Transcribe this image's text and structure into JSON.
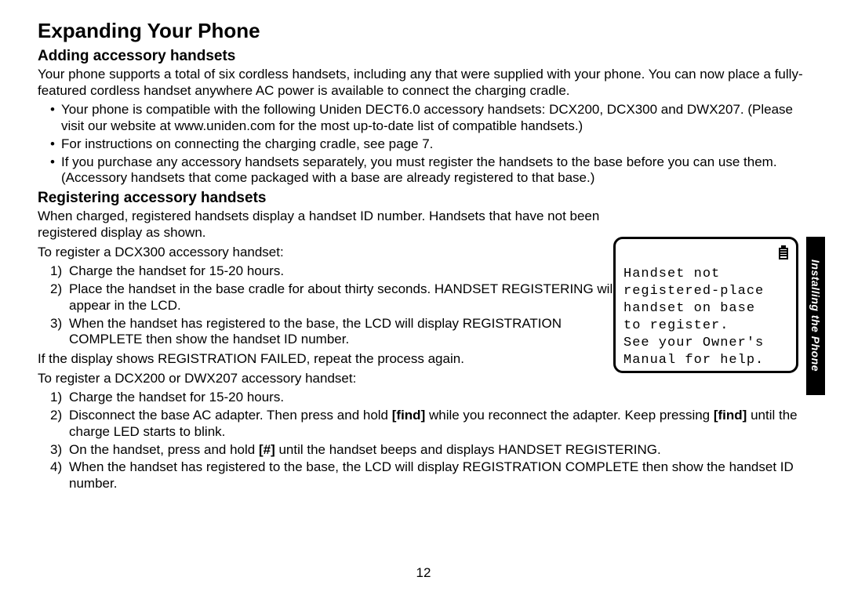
{
  "title": "Expanding Your Phone",
  "side_tab": "Installing the Phone",
  "page_number": "12",
  "sec1": {
    "heading": "Adding accessory handsets",
    "intro": "Your phone supports a total of six cordless handsets, including any that were supplied with your phone. You can now place a fully-featured cordless handset anywhere AC power is available to connect the charging cradle.",
    "bullets": [
      "Your phone is compatible with the following Uniden DECT6.0 accessory handsets: DCX200, DCX300 and DWX207. (Please visit our website at www.uniden.com for the most up-to-date list of compatible handsets.)",
      "For instructions on connecting the charging cradle, see page 7.",
      "If you purchase any accessory handsets separately, you must register the handsets to the base before you can use them. (Accessory handsets that come packaged with a base are already registered to that base.)"
    ]
  },
  "sec2": {
    "heading": "Registering accessory handsets",
    "p1": "When charged, registered handsets display a handset ID number. Handsets that have not been registered display as shown.",
    "p2": "To register a DCX300 accessory handset:",
    "steps1": [
      "Charge the handset for 15-20 hours.",
      "Place the handset in the base cradle for about thirty seconds. HANDSET REGISTERING will appear in the LCD.",
      "When the handset has registered to the base, the LCD will display REGISTRATION COMPLETE then show the handset ID number."
    ],
    "p3": "If the display shows REGISTRATION FAILED, repeat the process again.",
    "p4": "To register a DCX200 or DWX207 accessory handset:",
    "steps2_1": "Charge the handset for 15-20 hours.",
    "steps2_2a": "Disconnect the base AC adapter. Then press and hold ",
    "steps2_2b": "[find]",
    "steps2_2c": " while you reconnect the adapter. Keep pressing ",
    "steps2_2d": "[find]",
    "steps2_2e": " until the charge LED starts to blink.",
    "steps2_3a": "On the handset, press and hold ",
    "steps2_3b": "[#]",
    "steps2_3c": " until the handset beeps and displays HANDSET REGISTERING.",
    "steps2_4": "When the handset has registered to the base, the LCD will display REGISTRATION COMPLETE then show the handset ID number."
  },
  "lcd": {
    "l1": "Handset not",
    "l2": "registered-place",
    "l3": "handset on base",
    "l4": "to register.",
    "l5": "See your Owner's",
    "l6": "Manual for help."
  }
}
